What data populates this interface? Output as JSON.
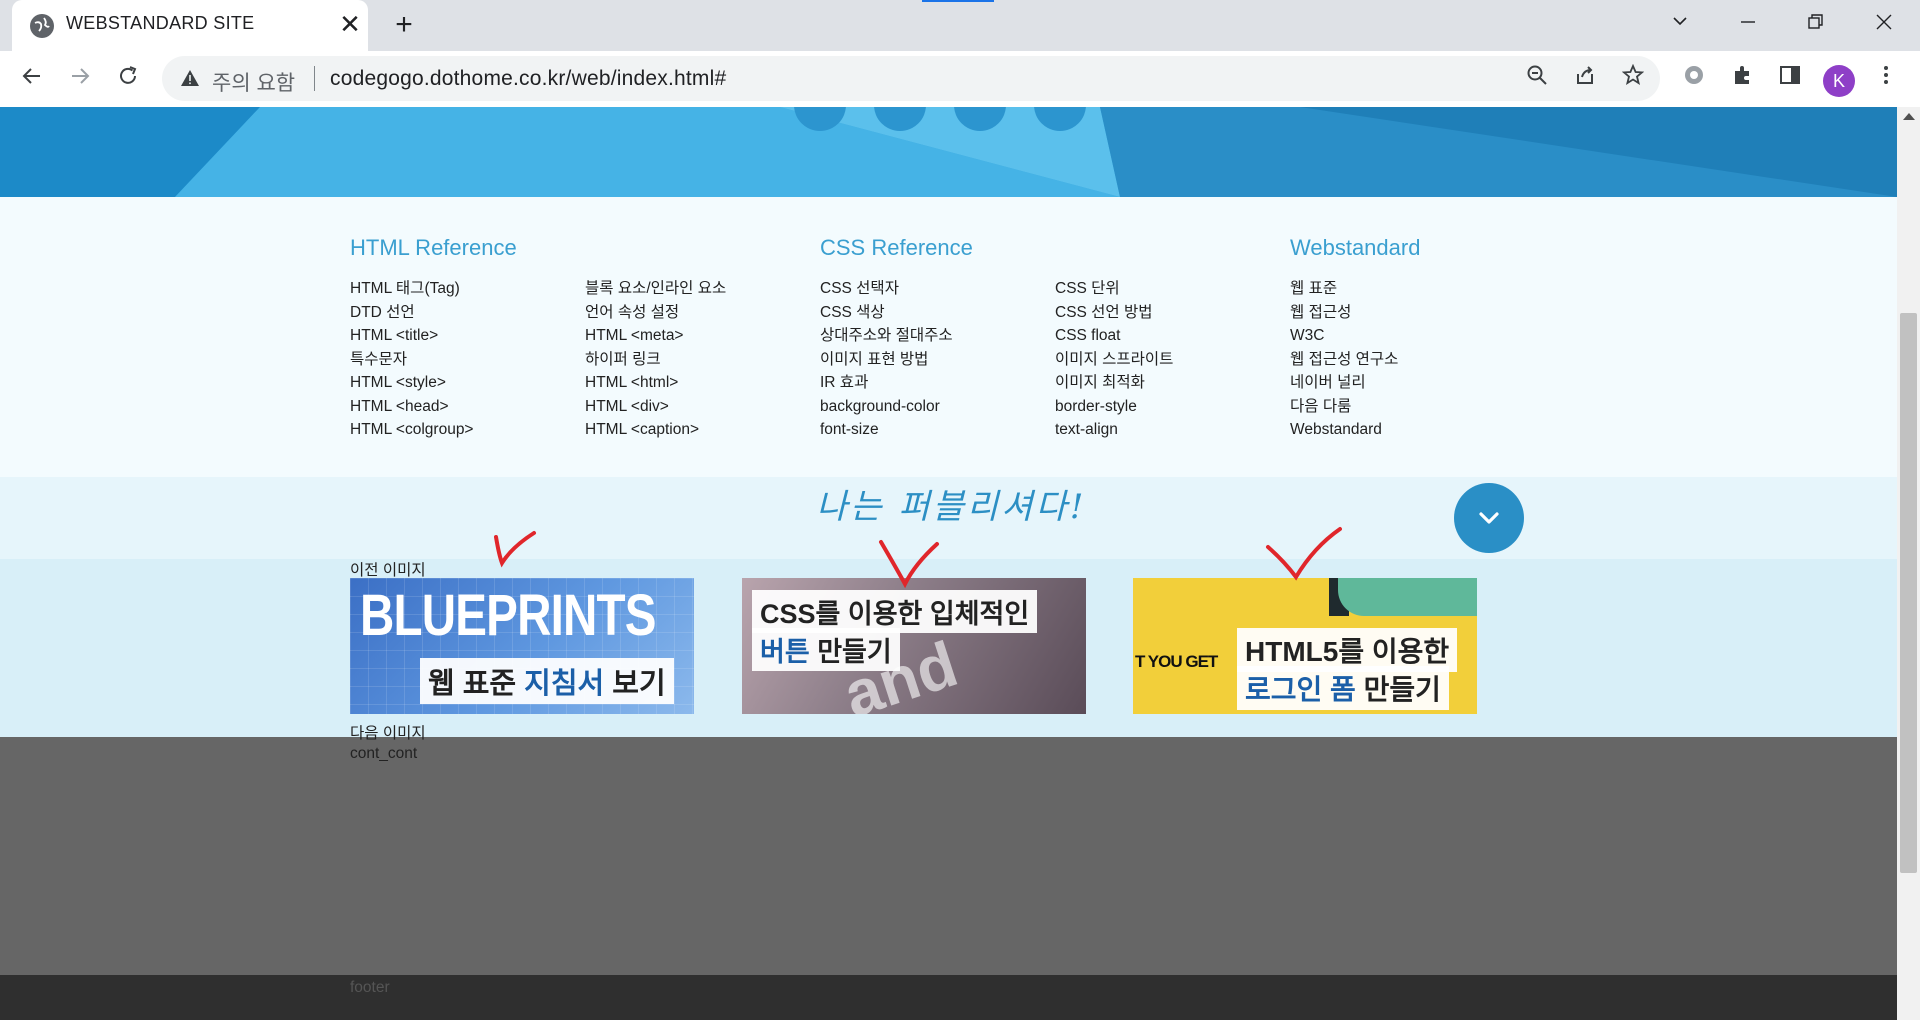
{
  "browser": {
    "tab_title": "WEBSTANDARD SITE",
    "tab_close": "✕",
    "new_tab": "+",
    "security_label": "주의 요함",
    "url": "codegogo.dothome.co.kr/web/index.html#",
    "avatar_letter": "K"
  },
  "columns": [
    {
      "heading": "HTML Reference",
      "items": [
        "HTML 태그(Tag)",
        "DTD 선언",
        "HTML <title>",
        "특수문자",
        "HTML <style>",
        "HTML <head>",
        "HTML <colgroup>"
      ]
    },
    {
      "heading": "",
      "items": [
        "블록 요소/인라인 요소",
        "언어 속성 설정",
        "HTML <meta>",
        "하이퍼 링크",
        "HTML <html>",
        "HTML <div>",
        "HTML <caption>"
      ]
    },
    {
      "heading": "CSS Reference",
      "items": [
        "CSS 선택자",
        "CSS 색상",
        "상대주소와 절대주소",
        "이미지 표현 방법",
        "IR 효과",
        "background-color",
        "font-size"
      ]
    },
    {
      "heading": "",
      "items": [
        "CSS 단위",
        "CSS 선언 방법",
        "CSS float",
        "이미지 스프라이트",
        "이미지 최적화",
        "border-style",
        "text-align"
      ]
    },
    {
      "heading": "Webstandard",
      "items": [
        "웹 표준",
        "웹 접근성",
        "W3C",
        "웹 접근성 연구소",
        "네이버 널리",
        "다음 다룸",
        "Webstandard"
      ]
    }
  ],
  "banner": {
    "handwriting": "나는 퍼블리셔다!"
  },
  "gallery": {
    "prev_label": "이전 이미지",
    "next_label": "다음 이미지",
    "cont_label": "cont_cont",
    "cards": [
      {
        "bg_title": "BLUEPRINTS",
        "caption_plain_1": "웹 표준 ",
        "caption_blue": "지침서",
        "caption_plain_2": " 보기"
      },
      {
        "deco_text": "and inte",
        "line1": "CSS를 이용한 입체적인",
        "line2_blue": "버튼",
        "line2_plain": " 만들기"
      },
      {
        "side_text": "T YOU GET",
        "line1": "HTML5를 이용한",
        "line2_blue": "로그인 폼",
        "line2_plain": " 만들기"
      }
    ]
  },
  "footer": {
    "label": "footer"
  },
  "colors": {
    "accent": "#3a9fd0",
    "hero": "#2d9fd9",
    "check_red": "#e0262b"
  }
}
